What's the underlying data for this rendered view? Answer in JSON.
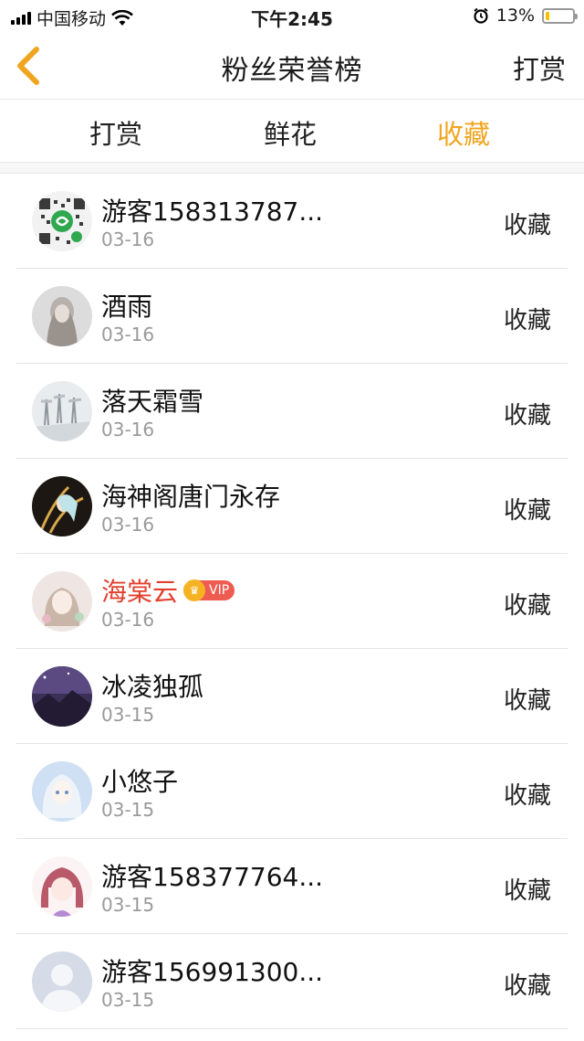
{
  "status": {
    "carrier": "中国移动",
    "time": "下午2:45",
    "battery_percent": "13%",
    "battery_level": 0.13
  },
  "nav": {
    "title": "粉丝荣誉榜",
    "right_label": "打赏"
  },
  "tabs": [
    {
      "label": "打赏",
      "active": false
    },
    {
      "label": "鲜花",
      "active": false
    },
    {
      "label": "收藏",
      "active": true
    }
  ],
  "colors": {
    "accent": "#f0a520",
    "vip_name": "#e2402d"
  },
  "fans": [
    {
      "name": "游客158313787...",
      "date": "03-16",
      "action": "收藏",
      "vip": false
    },
    {
      "name": "酒雨",
      "date": "03-16",
      "action": "收藏",
      "vip": false
    },
    {
      "name": "落天霜雪",
      "date": "03-16",
      "action": "收藏",
      "vip": false
    },
    {
      "name": "海神阁唐门永存",
      "date": "03-16",
      "action": "收藏",
      "vip": false
    },
    {
      "name": "海棠云",
      "date": "03-16",
      "action": "收藏",
      "vip": true,
      "vip_label": "VIP"
    },
    {
      "name": "冰凌独孤",
      "date": "03-15",
      "action": "收藏",
      "vip": false
    },
    {
      "name": "小悠子",
      "date": "03-15",
      "action": "收藏",
      "vip": false
    },
    {
      "name": "游客158377764...",
      "date": "03-15",
      "action": "收藏",
      "vip": false
    },
    {
      "name": "游客156991300...",
      "date": "03-15",
      "action": "收藏",
      "vip": false
    }
  ]
}
